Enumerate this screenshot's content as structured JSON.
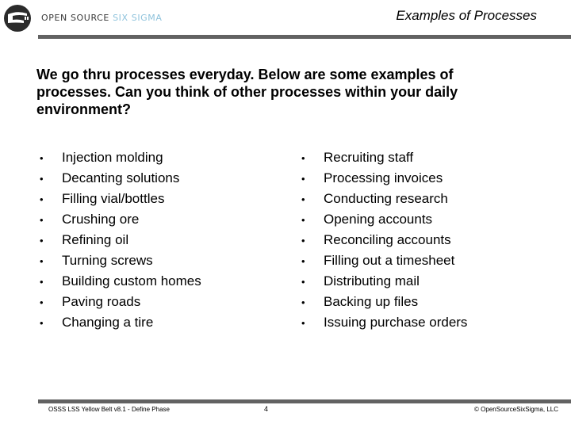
{
  "header": {
    "brand_part1": "OPEN SOURCE ",
    "brand_part2": "SIX SIGMA",
    "slide_title": "Examples of Processes",
    "logo_icon": "open-source-six-sigma-logo",
    "brand_accent_color": "#8fc3dc",
    "rule_color": "#626262"
  },
  "intro": "We go thru processes everyday.  Below are some examples of processes.  Can you think of other processes within your daily environment?",
  "lists": {
    "bullet": "•",
    "left": [
      "Injection molding",
      "Decanting solutions",
      "Filling vial/bottles",
      "Crushing ore",
      "Refining oil",
      "Turning screws",
      "Building custom homes",
      "Paving roads",
      "Changing a tire"
    ],
    "right": [
      "Recruiting staff",
      "Processing invoices",
      "Conducting research",
      "Opening accounts",
      "Reconciling accounts",
      "Filling out a timesheet",
      "Distributing mail",
      "Backing up files",
      "Issuing purchase orders"
    ]
  },
  "footer": {
    "course": "OSSS LSS Yellow Belt v8.1 - Define Phase",
    "page_number": "4",
    "copyright": "© OpenSourceSixSigma, LLC"
  }
}
